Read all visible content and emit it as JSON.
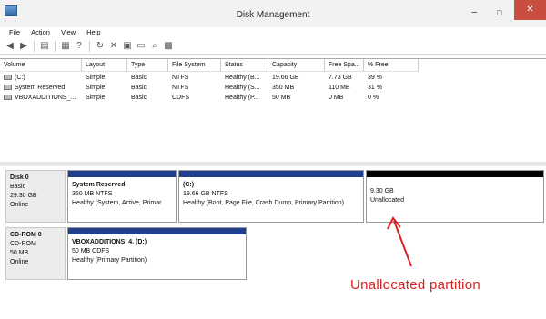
{
  "window": {
    "title": "Disk Management",
    "min": "−",
    "max": "□",
    "close": "✕"
  },
  "menu": [
    {
      "label": "File"
    },
    {
      "label": "Action"
    },
    {
      "label": "View"
    },
    {
      "label": "Help"
    }
  ],
  "toolbar": [
    {
      "name": "back-icon",
      "glyph": "◀"
    },
    {
      "name": "forward-icon",
      "glyph": "▶"
    },
    {
      "name": "console-tree-icon",
      "glyph": "▤"
    },
    {
      "name": "properties-icon",
      "glyph": "▦"
    },
    {
      "name": "help-icon",
      "glyph": "?"
    },
    {
      "name": "refresh-icon",
      "glyph": "↻"
    },
    {
      "name": "delete-icon",
      "glyph": "✕"
    },
    {
      "name": "connect-icon",
      "glyph": "▣"
    },
    {
      "name": "open-folder-icon",
      "glyph": "▭"
    },
    {
      "name": "search-icon",
      "glyph": "⌕"
    },
    {
      "name": "view-icon",
      "glyph": "▩"
    }
  ],
  "volume_table": {
    "headers": [
      "Volume",
      "Layout",
      "Type",
      "File System",
      "Status",
      "Capacity",
      "Free Spa...",
      "% Free"
    ],
    "rows": [
      [
        "(C:)",
        "Simple",
        "Basic",
        "NTFS",
        "Healthy (B...",
        "19.66 GB",
        "7.73 GB",
        "39 %"
      ],
      [
        "System Reserved",
        "Simple",
        "Basic",
        "NTFS",
        "Healthy (S...",
        "350 MB",
        "110 MB",
        "31 %"
      ],
      [
        "VBOXADDITIONS_...",
        "Simple",
        "Basic",
        "CDFS",
        "Healthy (P...",
        "50 MB",
        "0 MB",
        "0 %"
      ]
    ]
  },
  "disks": [
    {
      "label": {
        "name": "Disk 0",
        "type": "Basic",
        "size": "29.30 GB",
        "state": "Online"
      },
      "partitions": [
        {
          "title": "System Reserved",
          "size_fs": "350 MB NTFS",
          "status": "Healthy (System, Active, Primar",
          "bar": "blue"
        },
        {
          "title": "(C:)",
          "size_fs": "19.66 GB NTFS",
          "status": "Healthy (Boot, Page File, Crash Dump, Primary Partition)",
          "bar": "blue"
        },
        {
          "title": "",
          "size_fs": "9.30 GB",
          "status": "Unallocated",
          "bar": "black"
        }
      ]
    },
    {
      "label": {
        "name": "CD-ROM 0",
        "type": "CD-ROM",
        "size": "50 MB",
        "state": "Online"
      },
      "partitions": [
        {
          "title": "VBOXADDITIONS_4.  (D:)",
          "size_fs": "50 MB CDFS",
          "status": "Healthy (Primary Partition)",
          "bar": "blue"
        }
      ]
    }
  ],
  "annotation": {
    "text": "Unallocated partition",
    "color": "#d92020"
  }
}
